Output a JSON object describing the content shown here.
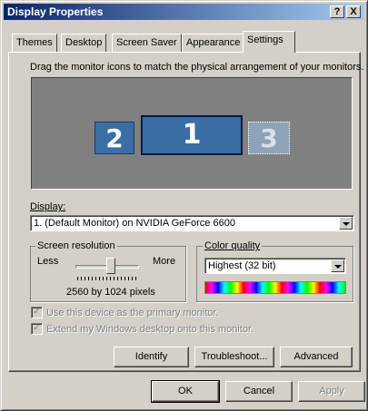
{
  "window": {
    "title": "Display Properties",
    "help_glyph": "?",
    "close_glyph": "X"
  },
  "tabs": [
    {
      "label": "Themes"
    },
    {
      "label": "Desktop"
    },
    {
      "label": "Screen Saver"
    },
    {
      "label": "Appearance"
    },
    {
      "label": "Settings"
    }
  ],
  "active_tab": "Settings",
  "settings": {
    "instruction": "Drag the monitor icons to match the physical arrangement of your monitors.",
    "monitors": [
      {
        "number": "2"
      },
      {
        "number": "1"
      },
      {
        "number": "3"
      }
    ],
    "display_label": "Display:",
    "display_value": "1. (Default Monitor) on NVIDIA GeForce 6600",
    "resolution": {
      "label": "Screen resolution",
      "less": "Less",
      "more": "More",
      "value": "2560 by 1024 pixels"
    },
    "color_quality": {
      "label": "Color quality",
      "value": "Highest (32 bit)"
    },
    "primary_checkbox": "Use this device as the primary monitor.",
    "extend_checkbox": "Extend my Windows desktop onto this monitor.",
    "buttons": {
      "identify": "Identify",
      "troubleshoot": "Troubleshoot...",
      "advanced": "Advanced"
    }
  },
  "footer": {
    "ok": "OK",
    "cancel": "Cancel",
    "apply": "Apply"
  }
}
